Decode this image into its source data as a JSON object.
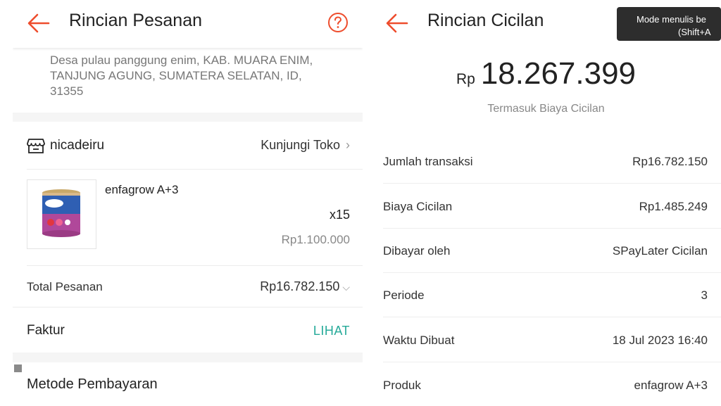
{
  "left": {
    "header": {
      "title": "Rincian Pesanan"
    },
    "address": {
      "lines": [
        "Desa pulau panggung enim, KAB. MUARA ENIM,",
        "TANJUNG AGUNG, SUMATERA SELATAN, ID,",
        "31355"
      ]
    },
    "shop": {
      "name": "nicadeiru",
      "visit_label": "Kunjungi Toko",
      "visit_chevron": "›"
    },
    "product": {
      "name": "enfagrow A+3",
      "quantity": "x15",
      "price": "Rp1.100.000"
    },
    "total": {
      "label": "Total Pesanan",
      "value": "Rp16.782.150",
      "chevron": "⌵"
    },
    "invoice": {
      "label": "Faktur",
      "action": "LIHAT"
    },
    "payment_method": {
      "label": "Metode Pembayaran"
    }
  },
  "right": {
    "header": {
      "title": "Rincian Cicilan"
    },
    "amount": {
      "currency": "Rp",
      "value": "18.267.399",
      "subtitle": "Termasuk Biaya Cicilan"
    },
    "rows": [
      {
        "label": "Jumlah transaksi",
        "value": "Rp16.782.150"
      },
      {
        "label": "Biaya Cicilan",
        "value": "Rp1.485.249"
      },
      {
        "label": "Dibayar oleh",
        "value": "SPayLater Cicilan"
      },
      {
        "label": "Periode",
        "value": "3"
      },
      {
        "label": "Waktu Dibuat",
        "value": "18 Jul 2023 16:40"
      },
      {
        "label": "Produk",
        "value": "enfagrow A+3"
      }
    ]
  },
  "tooltip": {
    "line1": "Mode menulis be",
    "line2": "(Shift+A"
  },
  "colors": {
    "accent": "#ee4d2d",
    "link": "#26aa99"
  }
}
